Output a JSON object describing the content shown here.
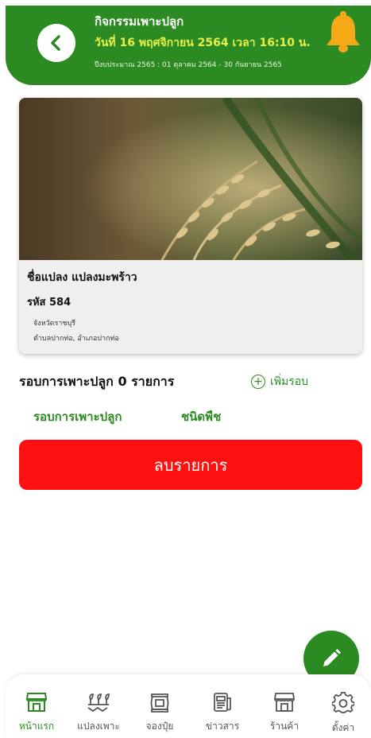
{
  "header": {
    "title": "กิจกรรมเพาะปลูก",
    "date_line": "วันที่ 16 พฤศจิกายน 2564 เวลา 16:10 น.",
    "budget_line": "ปีงบประมาณ 2565 : 01 ตุลาคม 2564 - 30 กันยายน 2565",
    "back_icon": "chevron-left-icon",
    "notification_icon": "bell-icon"
  },
  "plot": {
    "name": "ชื่อแปลง แปลงมะพร้าว",
    "code": "รหัส 584",
    "province": "จังหวัดราชบุรี",
    "district": "ตำบลปากท่อ, อำเภอปากท่อ"
  },
  "rounds": {
    "title": "รอบการเพาะปลูก 0 รายการ",
    "add_label": "เพิ่มรอบ",
    "tabs": [
      "รอบการเพาะปลูก",
      "ชนิดพืช"
    ]
  },
  "delete_label": "ลบรายการ",
  "nav": [
    {
      "label": "หน้าแรก",
      "icon": "store-icon",
      "active": true
    },
    {
      "label": "แปลงเพาะ",
      "icon": "sprout-icon",
      "active": false
    },
    {
      "label": "จองปุ๋ย",
      "icon": "fertilizer-bag-icon",
      "active": false
    },
    {
      "label": "ข่าวสาร",
      "icon": "newspaper-icon",
      "active": false
    },
    {
      "label": "ร้านค้า",
      "icon": "shop-icon",
      "active": false
    },
    {
      "label": "ตั้งค่า",
      "icon": "gear-icon",
      "active": false
    }
  ],
  "colors": {
    "primary": "#2c8a22",
    "date_yellow": "#e7f04a",
    "bell_orange": "#f6a917",
    "danger": "#ff1010"
  }
}
